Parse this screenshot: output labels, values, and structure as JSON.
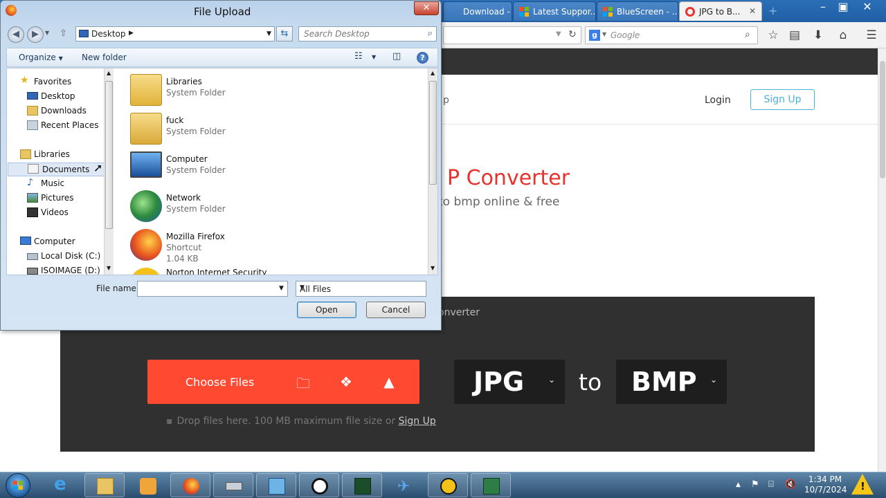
{
  "browser": {
    "tabs": [
      {
        "label": "Download - ...",
        "icon": "download-tab-icon"
      },
      {
        "label": "Latest Suppor...",
        "icon": "windows-logo-icon"
      },
      {
        "label": "BlueScreen - ...",
        "icon": "windows-logo-icon"
      },
      {
        "label": "JPG to B...",
        "icon": "cloudconvert-icon",
        "active": true
      }
    ],
    "search_placeholder": "Google"
  },
  "webpage": {
    "nav_fragment": "p",
    "login": "Login",
    "signup": "Sign Up",
    "hero_title": "P Converter",
    "hero_subtitle": "to bmp online & free",
    "breadcrumb": "onverter",
    "choose_files": "Choose Files",
    "from_format": "JPG",
    "to_word": "to",
    "to_format": "BMP",
    "drop_text": "Drop files here. 100 MB maximum file size or",
    "drop_signup": "Sign Up",
    "accent_color": "#ff4a31"
  },
  "dialog": {
    "title": "File Upload",
    "address": "Desktop",
    "search_placeholder": "Search Desktop",
    "toolbar": {
      "organize": "Organize",
      "new_folder": "New folder"
    },
    "nav": {
      "favorites": "Favorites",
      "favorites_items": [
        "Desktop",
        "Downloads",
        "Recent Places"
      ],
      "libraries": "Libraries",
      "libraries_items": [
        "Documents",
        "Music",
        "Pictures",
        "Videos"
      ],
      "computer": "Computer",
      "computer_items": [
        "Local Disk (C:)",
        "ISOIMAGE (D:)"
      ]
    },
    "files": [
      {
        "name": "Libraries",
        "type": "System Folder",
        "size": ""
      },
      {
        "name": "fuck",
        "type": "System Folder",
        "size": ""
      },
      {
        "name": "Computer",
        "type": "System Folder",
        "size": ""
      },
      {
        "name": "Network",
        "type": "System Folder",
        "size": ""
      },
      {
        "name": "Mozilla Firefox",
        "type": "Shortcut",
        "size": "1.04 KB"
      },
      {
        "name": "Norton Internet Security",
        "type": "",
        "size": ""
      }
    ],
    "file_name_label": "File name:",
    "file_name_value": "",
    "filter": "All Files",
    "open": "Open",
    "cancel": "Cancel"
  },
  "taskbar": {
    "time": "1:34 PM",
    "date": "10/7/2024"
  }
}
